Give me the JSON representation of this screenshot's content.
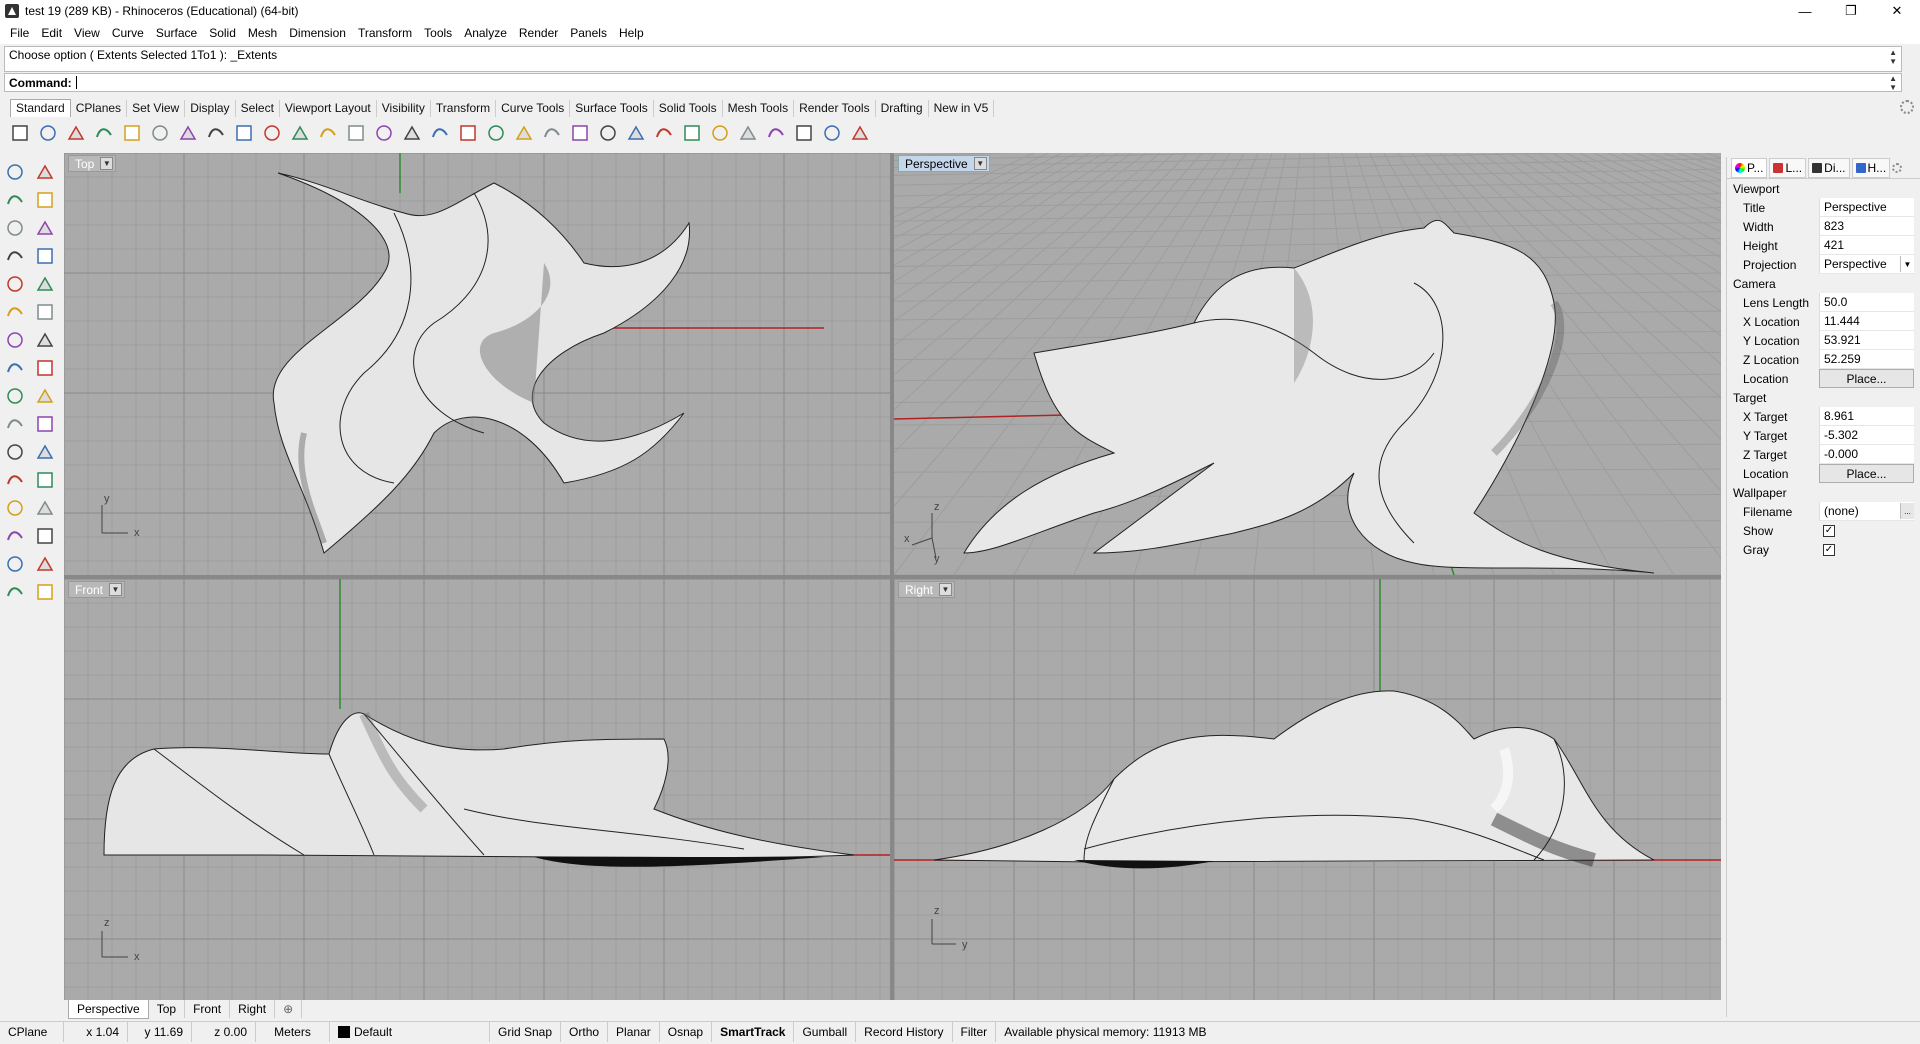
{
  "window": {
    "title": "test 19 (289 KB) - Rhinoceros (Educational) (64-bit)"
  },
  "menu": [
    "File",
    "Edit",
    "View",
    "Curve",
    "Surface",
    "Solid",
    "Mesh",
    "Dimension",
    "Transform",
    "Tools",
    "Analyze",
    "Render",
    "Panels",
    "Help"
  ],
  "command": {
    "history": "Choose option ( Extents  Selected  1To1 ): _Extents",
    "label": "Command:",
    "value": ""
  },
  "tooltabs": [
    "Standard",
    "CPlanes",
    "Set View",
    "Display",
    "Select",
    "Viewport Layout",
    "Visibility",
    "Transform",
    "Curve Tools",
    "Surface Tools",
    "Solid Tools",
    "Mesh Tools",
    "Render Tools",
    "Drafting",
    "New in V5"
  ],
  "toolbar_icons": [
    "new-file-icon",
    "open-file-icon",
    "save-icon",
    "print-icon",
    "import-icon",
    "cut-icon",
    "copy-icon",
    "paste-icon",
    "undo-icon",
    "pan-hand-icon",
    "move-view-icon",
    "zoom-in-icon",
    "zoom-window-icon",
    "zoom-extents-icon",
    "zoom-selected-icon",
    "rotate-view-icon",
    "four-viewports-icon",
    "car-icon",
    "camera-icon",
    "cplane-icon",
    "lightbulb-icon",
    "lock-icon",
    "layer-icon",
    "color-wheel-icon",
    "render-sphere-icon",
    "material-sphere-icon",
    "environment-sphere-icon",
    "filter-icon",
    "gear-settings-icon",
    "dimension-icon",
    "help-icon"
  ],
  "left_tool_icons": [
    "select-arrow-icon",
    "point-icon",
    "polyline-icon",
    "curve-icon",
    "circle-icon",
    "ellipse-icon",
    "arc-icon",
    "rectangle-icon",
    "polygon-icon",
    "offset-curve-icon",
    "surface-icon",
    "extrude-icon",
    "box-icon",
    "sphere-icon",
    "cylinder-icon",
    "plane-icon",
    "boolean-icon",
    "explode-icon",
    "trim-icon",
    "split-icon",
    "join-icon",
    "group-icon",
    "fillet-icon",
    "chamfer-icon",
    "text-icon",
    "dimension-tool-icon",
    "array-icon",
    "mirror-icon",
    "scale-icon",
    "check-icon",
    "mesh-icon",
    "analyze-icon"
  ],
  "viewports": {
    "top": {
      "label": "Top",
      "axis1": "x",
      "axis2": "y"
    },
    "perspective": {
      "label": "Perspective",
      "axis1": "x",
      "axis2": "y",
      "axis3": "z"
    },
    "front": {
      "label": "Front",
      "axis1": "x",
      "axis2": "z"
    },
    "right": {
      "label": "Right",
      "axis1": "y",
      "axis2": "z"
    }
  },
  "viewport_tabs": [
    "Perspective",
    "Top",
    "Front",
    "Right"
  ],
  "add_tab_glyph": "⊕",
  "panel": {
    "tabs": [
      "P...",
      "L...",
      "Di...",
      "H..."
    ],
    "sections": {
      "viewport": "Viewport",
      "camera": "Camera",
      "target": "Target",
      "wallpaper": "Wallpaper"
    },
    "viewport_rows": [
      {
        "key": "Title",
        "value": "Perspective"
      },
      {
        "key": "Width",
        "value": "823"
      },
      {
        "key": "Height",
        "value": "421"
      },
      {
        "key": "Projection",
        "value": "Perspective"
      }
    ],
    "camera_rows": [
      {
        "key": "Lens Length",
        "value": "50.0"
      },
      {
        "key": "X Location",
        "value": "11.444"
      },
      {
        "key": "Y Location",
        "value": "53.921"
      },
      {
        "key": "Z Location",
        "value": "52.259"
      },
      {
        "key": "Location",
        "value": "Place..."
      }
    ],
    "target_rows": [
      {
        "key": "X Target",
        "value": "8.961"
      },
      {
        "key": "Y Target",
        "value": "-5.302"
      },
      {
        "key": "Z Target",
        "value": "-0.000"
      },
      {
        "key": "Location",
        "value": "Place..."
      }
    ],
    "wallpaper_rows": [
      {
        "key": "Filename",
        "value": "(none)"
      },
      {
        "key": "Show",
        "value": "✓"
      },
      {
        "key": "Gray",
        "value": "✓"
      }
    ],
    "browse_glyph": "..."
  },
  "status": {
    "cplane": "CPlane",
    "x": "x 1.04",
    "y": "y 11.69",
    "z": "z 0.00",
    "units": "Meters",
    "layer": "Default",
    "grid_snap": "Grid Snap",
    "ortho": "Ortho",
    "planar": "Planar",
    "osnap": "Osnap",
    "smarttrack": "SmartTrack",
    "gumball": "Gumball",
    "record_history": "Record History",
    "filter": "Filter",
    "memory": "Available physical memory: 11913 MB"
  },
  "colors": {
    "viewport_bg": "#aaaaaa",
    "grid_minor": "#9d9d9d",
    "grid_major": "#8a8a8a",
    "x_axis": "#b22222",
    "y_axis": "#2e8b2e",
    "active_viewport_title": "#c4d6ea"
  }
}
